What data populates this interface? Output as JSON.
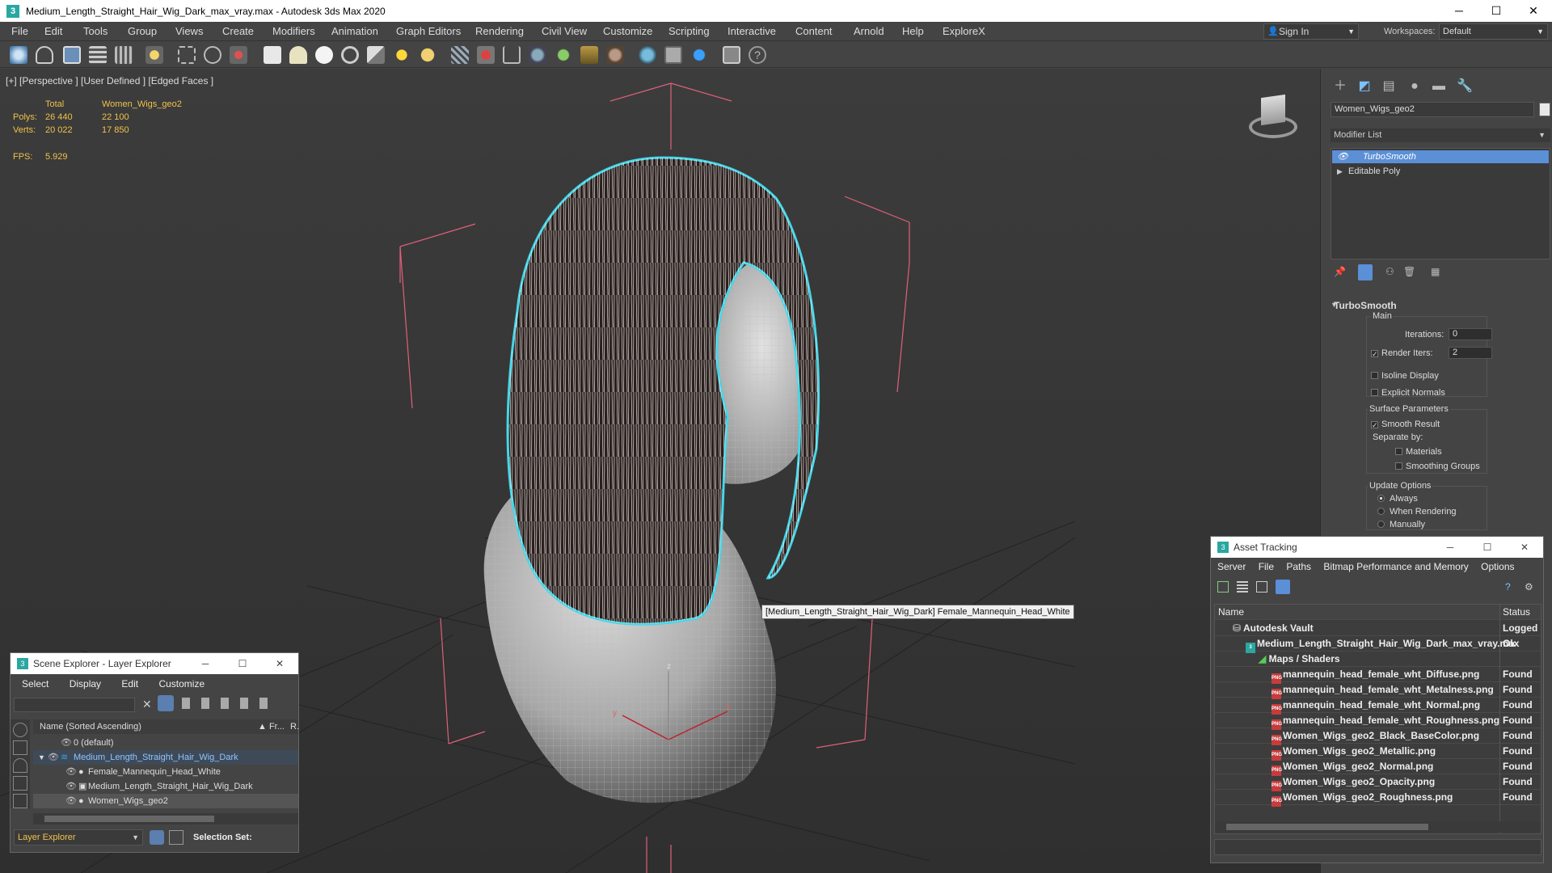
{
  "window": {
    "title": "Medium_Length_Straight_Hair_Wig_Dark_max_vray.max - Autodesk 3ds Max 2020",
    "app_icon": "3",
    "minimize": "─",
    "maximize": "☐",
    "close": "✕"
  },
  "menu": [
    "File",
    "Edit",
    "Tools",
    "Group",
    "Views",
    "Create",
    "Modifiers",
    "Animation",
    "Graph Editors",
    "Rendering",
    "Civil View",
    "Customize",
    "Scripting",
    "Interactive",
    "Content",
    "Arnold",
    "Help",
    "ExploreX"
  ],
  "account": {
    "sign_in": "Sign In",
    "workspaces_label": "Workspaces:",
    "workspace": "Default"
  },
  "viewport": {
    "label": "[+] [Perspective ] [User Defined ] [Edged Faces ]",
    "stats": {
      "col_total": "Total",
      "col_object": "Women_Wigs_geo2",
      "polys_label": "Polys:",
      "polys_total": "26 440",
      "polys_object": "22 100",
      "verts_label": "Verts:",
      "verts_total": "20 022",
      "verts_object": "17 850",
      "fps_label": "FPS:",
      "fps_value": "5.929"
    },
    "tooltip": "[Medium_Length_Straight_Hair_Wig_Dark] Female_Mannequin_Head_White",
    "axis_z": "z",
    "axis_x": "x",
    "axis_y": "y"
  },
  "command_panel": {
    "object_name": "Women_Wigs_geo2",
    "modifier_list_label": "Modifier List",
    "stack": [
      "TurboSmooth",
      "Editable Poly"
    ],
    "rollout": {
      "title": "TurboSmooth",
      "main_label": "Main",
      "iterations_label": "Iterations:",
      "iterations": "0",
      "render_iters_label": "Render Iters:",
      "render_iters": "2",
      "isoline_display": "Isoline Display",
      "explicit_normals": "Explicit Normals",
      "surface_params": "Surface Parameters",
      "smooth_result": "Smooth Result",
      "separate_by": "Separate by:",
      "materials": "Materials",
      "smoothing_groups": "Smoothing Groups",
      "update_options": "Update Options",
      "always": "Always",
      "when_rendering": "When Rendering",
      "manually": "Manually"
    }
  },
  "scene_explorer": {
    "title": "Scene Explorer - Layer Explorer",
    "menus": [
      "Select",
      "Display",
      "Edit",
      "Customize"
    ],
    "col_name": "Name (Sorted Ascending)",
    "col_fr": "▲ Fr...",
    "col_r": "R.",
    "rows": [
      "0 (default)",
      "Medium_Length_Straight_Hair_Wig_Dark",
      "Female_Mannequin_Head_White",
      "Medium_Length_Straight_Hair_Wig_Dark",
      "Women_Wigs_geo2"
    ],
    "footer_dropdown": "Layer Explorer",
    "selection_set": "Selection Set:"
  },
  "asset_tracking": {
    "title": "Asset Tracking",
    "menus": [
      "Server",
      "File",
      "Paths",
      "Bitmap Performance and Memory",
      "Options"
    ],
    "col_name": "Name",
    "col_status": "Status",
    "rows": [
      {
        "name": "Autodesk Vault",
        "status": "Logged O"
      },
      {
        "name": "Medium_Length_Straight_Hair_Wig_Dark_max_vray.max",
        "status": "Ok"
      },
      {
        "name": "Maps / Shaders",
        "status": ""
      },
      {
        "name": "mannequin_head_female_wht_Diffuse.png",
        "status": "Found"
      },
      {
        "name": "mannequin_head_female_wht_Metalness.png",
        "status": "Found"
      },
      {
        "name": "mannequin_head_female_wht_Normal.png",
        "status": "Found"
      },
      {
        "name": "mannequin_head_female_wht_Roughness.png",
        "status": "Found"
      },
      {
        "name": "Women_Wigs_geo2_Black_BaseColor.png",
        "status": "Found"
      },
      {
        "name": "Women_Wigs_geo2_Metallic.png",
        "status": "Found"
      },
      {
        "name": "Women_Wigs_geo2_Normal.png",
        "status": "Found"
      },
      {
        "name": "Women_Wigs_geo2_Opacity.png",
        "status": "Found"
      },
      {
        "name": "Women_Wigs_geo2_Roughness.png",
        "status": "Found"
      }
    ]
  },
  "colors": {
    "accent": "#4a90d9",
    "selection_cyan": "#43d6e8",
    "gizmo_pink": "#e0607a",
    "stats_yellow": "#f0c24a"
  }
}
